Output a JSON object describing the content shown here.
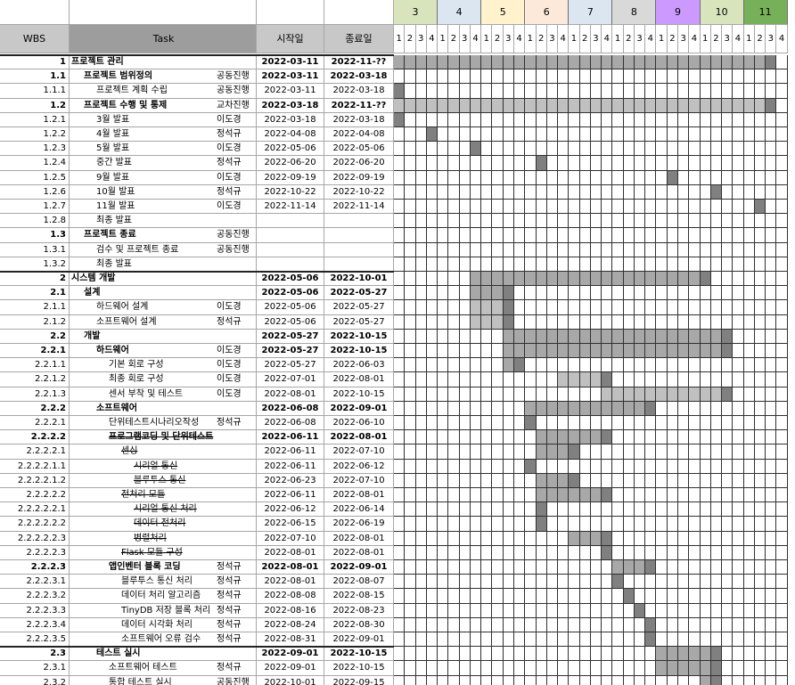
{
  "header": {
    "wbs": "WBS",
    "task": "Task",
    "start": "시작일",
    "end": "종료일"
  },
  "months": [
    {
      "label": "3",
      "color": "#d8e4bc"
    },
    {
      "label": "4",
      "color": "#dce6f1"
    },
    {
      "label": "5",
      "color": "#fff2cc"
    },
    {
      "label": "6",
      "color": "#fde9d9"
    },
    {
      "label": "7",
      "color": "#dce6f1"
    },
    {
      "label": "8",
      "color": "#d9d9d9"
    },
    {
      "label": "9",
      "color": "#cc99ff"
    },
    {
      "label": "10",
      "color": "#d8e4bc"
    },
    {
      "label": "11",
      "color": "#76b058"
    }
  ],
  "week_labels": [
    "1",
    "2",
    "3",
    "4"
  ],
  "rows": [
    {
      "wbs": "1",
      "task": "프로젝트 관리",
      "owner": "",
      "start": "2022-03-11",
      "end": "2022-11-??",
      "bold": true,
      "indent": 0,
      "bar": [
        0,
        35
      ],
      "dark": [
        34,
        35
      ],
      "topline": true
    },
    {
      "wbs": "1.1",
      "task": "프로젝트 범위정의",
      "owner": "공동진행",
      "start": "2022-03-11",
      "end": "2022-03-18",
      "bold": true,
      "indent": 1,
      "bar": [],
      "dark": []
    },
    {
      "wbs": "1.1.1",
      "task": "프로젝트 계획 수립",
      "owner": "공동진행",
      "start": "2022-03-11",
      "end": "2022-03-18",
      "bold": false,
      "indent": 2,
      "bar": [
        0,
        1
      ],
      "dark": [
        0,
        1
      ]
    },
    {
      "wbs": "1.2",
      "task": "프로젝트 수행 및 통제",
      "owner": "교차진행",
      "start": "2022-03-18",
      "end": "2022-11-??",
      "bold": true,
      "indent": 1,
      "bar": [
        0,
        35
      ],
      "dark": [
        34,
        35
      ],
      "light": true
    },
    {
      "wbs": "1.2.1",
      "task": "3월 발표",
      "owner": "이도경",
      "start": "2022-03-18",
      "end": "2022-03-18",
      "bold": false,
      "indent": 2,
      "bar": [
        0,
        1
      ],
      "dark": [
        0,
        1
      ]
    },
    {
      "wbs": "1.2.2",
      "task": "4월 발표",
      "owner": "정석규",
      "start": "2022-04-08",
      "end": "2022-04-08",
      "bold": false,
      "indent": 2,
      "bar": [
        3,
        4
      ],
      "dark": [
        3,
        4
      ]
    },
    {
      "wbs": "1.2.3",
      "task": "5월 발표",
      "owner": "이도경",
      "start": "2022-05-06",
      "end": "2022-05-06",
      "bold": false,
      "indent": 2,
      "bar": [
        7,
        8
      ],
      "dark": [
        7,
        8
      ]
    },
    {
      "wbs": "1.2.4",
      "task": "중간 발표",
      "owner": "정석규",
      "start": "2022-06-20",
      "end": "2022-06-20",
      "bold": false,
      "indent": 2,
      "bar": [
        13,
        14
      ],
      "dark": [
        13,
        14
      ]
    },
    {
      "wbs": "1.2.5",
      "task": "9월 발표",
      "owner": "이도경",
      "start": "2022-09-19",
      "end": "2022-09-19",
      "bold": false,
      "indent": 2,
      "bar": [
        25,
        26
      ],
      "dark": [
        25,
        26
      ]
    },
    {
      "wbs": "1.2.6",
      "task": "10월 발표",
      "owner": "정석규",
      "start": "2022-10-22",
      "end": "2022-10-22",
      "bold": false,
      "indent": 2,
      "bar": [
        29,
        30
      ],
      "dark": [
        29,
        30
      ]
    },
    {
      "wbs": "1.2.7",
      "task": "11월 발표",
      "owner": "이도경",
      "start": "2022-11-14",
      "end": "2022-11-14",
      "bold": false,
      "indent": 2,
      "bar": [
        33,
        34
      ],
      "dark": [
        33,
        34
      ]
    },
    {
      "wbs": "1.2.8",
      "task": "최종 발표",
      "owner": "",
      "start": "",
      "end": "",
      "bold": false,
      "indent": 2,
      "bar": [],
      "dark": []
    },
    {
      "wbs": "1.3",
      "task": "프로젝트 종료",
      "owner": "공동진행",
      "start": "",
      "end": "",
      "bold": true,
      "indent": 1,
      "bar": [],
      "dark": []
    },
    {
      "wbs": "1.3.1",
      "task": "검수 및 프로젝트 종료",
      "owner": "공동진행",
      "start": "",
      "end": "",
      "bold": false,
      "indent": 2,
      "bar": [],
      "dark": []
    },
    {
      "wbs": "1.3.2",
      "task": "최종 발표",
      "owner": "",
      "start": "",
      "end": "",
      "bold": false,
      "indent": 2,
      "bar": [],
      "dark": []
    },
    {
      "wbs": "2",
      "task": "시스템 개발",
      "owner": "",
      "start": "2022-05-06",
      "end": "2022-10-01",
      "bold": true,
      "indent": 0,
      "bar": [
        7,
        29
      ],
      "dark": [
        28,
        29
      ],
      "topline": true
    },
    {
      "wbs": "2.1",
      "task": "설계",
      "owner": "",
      "start": "2022-05-06",
      "end": "2022-05-27",
      "bold": true,
      "indent": 1,
      "bar": [
        7,
        11
      ],
      "dark": [
        10,
        11
      ]
    },
    {
      "wbs": "2.1.1",
      "task": "하드웨어 설계",
      "owner": "이도경",
      "start": "2022-05-06",
      "end": "2022-05-27",
      "bold": false,
      "indent": 2,
      "bar": [
        7,
        11
      ],
      "dark": [
        10,
        11
      ],
      "light": true
    },
    {
      "wbs": "2.1.2",
      "task": "소프트웨어 설계",
      "owner": "정석규",
      "start": "2022-05-06",
      "end": "2022-05-27",
      "bold": false,
      "indent": 2,
      "bar": [
        7,
        11
      ],
      "dark": [
        10,
        11
      ],
      "light": true
    },
    {
      "wbs": "2.2",
      "task": "개발",
      "owner": "",
      "start": "2022-05-27",
      "end": "2022-10-15",
      "bold": true,
      "indent": 1,
      "bar": [
        10,
        31
      ],
      "dark": [
        30,
        31
      ]
    },
    {
      "wbs": "2.2.1",
      "task": "하드웨어",
      "owner": "이도경",
      "start": "2022-05-27",
      "end": "2022-10-15",
      "bold": true,
      "indent": 2,
      "bar": [
        10,
        31
      ],
      "dark": [
        30,
        31
      ]
    },
    {
      "wbs": "2.2.1.1",
      "task": "기본 회로 구성",
      "owner": "이도경",
      "start": "2022-05-27",
      "end": "2022-06-03",
      "bold": false,
      "indent": 3,
      "bar": [
        10,
        12
      ],
      "dark": [
        11,
        12
      ]
    },
    {
      "wbs": "2.2.1.2",
      "task": "최종 회로 구성",
      "owner": "이도경",
      "start": "2022-07-01",
      "end": "2022-08-01",
      "bold": false,
      "indent": 3,
      "bar": [
        15,
        20
      ],
      "dark": [
        19,
        20
      ],
      "light": true
    },
    {
      "wbs": "2.2.1.3",
      "task": "센서 부착 및 테스트",
      "owner": "이도경",
      "start": "2022-08-01",
      "end": "2022-10-15",
      "bold": false,
      "indent": 3,
      "bar": [
        19,
        31
      ],
      "dark": [
        30,
        31
      ],
      "light": true
    },
    {
      "wbs": "2.2.2",
      "task": "소프트웨어",
      "owner": "",
      "start": "2022-06-08",
      "end": "2022-09-01",
      "bold": true,
      "indent": 2,
      "bar": [
        12,
        24
      ],
      "dark": [
        23,
        24
      ]
    },
    {
      "wbs": "2.2.2.1",
      "task": "단위테스트시나리오작성",
      "owner": "정석규",
      "start": "2022-06-08",
      "end": "2022-06-10",
      "bold": false,
      "indent": 3,
      "bar": [
        12,
        13
      ],
      "dark": [
        12,
        13
      ]
    },
    {
      "wbs": "2.2.2.2",
      "task": "프로그램코딩 및 단위테스트",
      "owner": "",
      "start": "2022-06-11",
      "end": "2022-08-01",
      "bold": true,
      "indent": 3,
      "bar": [
        13,
        20
      ],
      "dark": [
        19,
        20
      ],
      "strike": true
    },
    {
      "wbs": "2.2.2.2.1",
      "task": "센싱",
      "owner": "",
      "start": "2022-06-11",
      "end": "2022-07-10",
      "bold": false,
      "indent": 4,
      "bar": [
        13,
        17
      ],
      "dark": [
        16,
        17
      ],
      "strike": true
    },
    {
      "wbs": "2.2.2.2.1.1",
      "task": "시리얼 통신",
      "owner": "",
      "start": "2022-06-11",
      "end": "2022-06-12",
      "bold": false,
      "indent": 5,
      "bar": [
        12,
        13
      ],
      "dark": [
        12,
        13
      ],
      "strike": true
    },
    {
      "wbs": "2.2.2.2.1.2",
      "task": "블루투스 통신",
      "owner": "",
      "start": "2022-06-23",
      "end": "2022-07-10",
      "bold": false,
      "indent": 5,
      "bar": [
        13,
        17
      ],
      "dark": [
        16,
        17
      ],
      "strike": true
    },
    {
      "wbs": "2.2.2.2.2",
      "task": "전처리 모듈",
      "owner": "",
      "start": "2022-06-11",
      "end": "2022-08-01",
      "bold": false,
      "indent": 4,
      "bar": [
        13,
        20
      ],
      "dark": [
        19,
        20
      ],
      "strike": true
    },
    {
      "wbs": "2.2.2.2.2.1",
      "task": "시리얼 통신 처리",
      "owner": "",
      "start": "2022-06-12",
      "end": "2022-06-14",
      "bold": false,
      "indent": 5,
      "bar": [
        13,
        14
      ],
      "dark": [
        13,
        14
      ],
      "strike": true
    },
    {
      "wbs": "2.2.2.2.2.2",
      "task": "데이터 전처리",
      "owner": "",
      "start": "2022-06-15",
      "end": "2022-06-19",
      "bold": false,
      "indent": 5,
      "bar": [
        13,
        14
      ],
      "dark": [
        13,
        14
      ],
      "strike": true
    },
    {
      "wbs": "2.2.2.2.2.3",
      "task": "병렬처리",
      "owner": "",
      "start": "2022-07-10",
      "end": "2022-08-01",
      "bold": false,
      "indent": 5,
      "bar": [
        16,
        20
      ],
      "dark": [
        19,
        20
      ],
      "strike": true
    },
    {
      "wbs": "2.2.2.2.3",
      "task": "Flask 모듈 구성",
      "owner": "",
      "start": "2022-08-01",
      "end": "2022-08-01",
      "bold": false,
      "indent": 4,
      "bar": [
        19,
        20
      ],
      "dark": [
        19,
        20
      ],
      "strike": true
    },
    {
      "wbs": "2.2.2.3",
      "task": "앱인벤터 블록 코딩",
      "owner": "정석규",
      "start": "2022-08-01",
      "end": "2022-09-01",
      "bold": true,
      "indent": 3,
      "bar": [
        20,
        24
      ],
      "dark": [
        23,
        24
      ]
    },
    {
      "wbs": "2.2.2.3.1",
      "task": "블루투스 통신 처리",
      "owner": "정석규",
      "start": "2022-08-01",
      "end": "2022-08-07",
      "bold": false,
      "indent": 4,
      "bar": [
        20,
        21
      ],
      "dark": [
        20,
        21
      ]
    },
    {
      "wbs": "2.2.2.3.2",
      "task": "데이터 처리 알고리즘",
      "owner": "정석규",
      "start": "2022-08-08",
      "end": "2022-08-15",
      "bold": false,
      "indent": 4,
      "bar": [
        21,
        22
      ],
      "dark": [
        21,
        22
      ]
    },
    {
      "wbs": "2.2.2.3.3",
      "task": "TinyDB 저장 블록 처리",
      "owner": "정석규",
      "start": "2022-08-16",
      "end": "2022-08-23",
      "bold": false,
      "indent": 4,
      "bar": [
        22,
        23
      ],
      "dark": [
        22,
        23
      ]
    },
    {
      "wbs": "2.2.2.3.4",
      "task": "데이터 시각화 처리",
      "owner": "정석규",
      "start": "2022-08-24",
      "end": "2022-08-30",
      "bold": false,
      "indent": 4,
      "bar": [
        23,
        24
      ],
      "dark": [
        23,
        24
      ]
    },
    {
      "wbs": "2.2.2.3.5",
      "task": "소프트웨어 오류 검수",
      "owner": "정석규",
      "start": "2022-08-31",
      "end": "2022-09-01",
      "bold": false,
      "indent": 4,
      "bar": [
        23,
        24
      ],
      "dark": [
        23,
        24
      ]
    },
    {
      "wbs": "2.3",
      "task": "테스트 실시",
      "owner": "",
      "start": "2022-09-01",
      "end": "2022-10-15",
      "bold": true,
      "indent": 2,
      "bar": [
        24,
        30
      ],
      "dark": [
        29,
        30
      ],
      "topline": true
    },
    {
      "wbs": "2.3.1",
      "task": "소프트웨어 테스트",
      "owner": "정석규",
      "start": "2022-09-01",
      "end": "2022-10-15",
      "bold": false,
      "indent": 3,
      "bar": [
        24,
        30
      ],
      "dark": [
        29,
        30
      ]
    },
    {
      "wbs": "2.3.2",
      "task": "통합 테스트 실시",
      "owner": "공동진행",
      "start": "2022-10-01",
      "end": "2022-09-15",
      "bold": false,
      "indent": 3,
      "bar": [
        28,
        30
      ],
      "dark": [
        29,
        30
      ]
    }
  ]
}
